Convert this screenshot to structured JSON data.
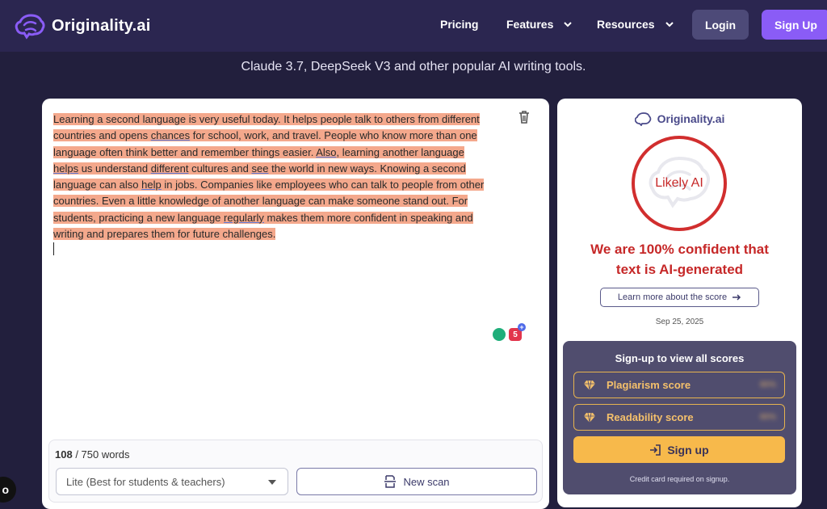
{
  "nav": {
    "brand": "Originality.ai",
    "links": [
      {
        "label": "Pricing"
      },
      {
        "label": "Features"
      },
      {
        "label": "Resources"
      }
    ],
    "login_label": "Login",
    "signup_label": "Sign Up"
  },
  "hero": {
    "line": "Claude 3.7, DeepSeek V3 and other popular AI writing tools."
  },
  "editor": {
    "text": {
      "s1": "Learning a second language is very useful today. It helps people talk to others from different countries and opens ",
      "w1": "chances",
      "s2": " for school, work, and travel. People who know more than one language often think better and remember things easier. ",
      "w2": "Also",
      "s3": ", learning another language ",
      "w3": "helps",
      "s4": " us understand ",
      "w4": "different",
      "s5": " cultures and ",
      "w5": "see",
      "s6": " the world in new ways. Knowing a second language can also ",
      "w6": "help",
      "s7": " in jobs. Companies like employees who can talk to people from other countries. Even a little knowledge of another language can make someone stand out. For students, practicing a new language ",
      "w7": "regularly",
      "s8": " makes them more confident in speaking and writing and prepares them for future challenges."
    },
    "extension_count": "5",
    "word_count": "108",
    "word_limit": " / 750 words",
    "mode_select": "Lite (Best for students & teachers)",
    "new_scan_label": "New scan"
  },
  "result": {
    "brand": "Originality.ai",
    "verdict": "Likely AI",
    "confidence_line1": "We are 100% confident that",
    "confidence_line2": "text is AI-generated",
    "learn_more_label": "Learn more about the score",
    "date": "Sep 25, 2025",
    "signup_box": {
      "title": "Sign-up to view all scores",
      "plagiarism_label": "Plagiarism score",
      "readability_label": "Readability score",
      "blurred_value": "80%",
      "cta_label": "Sign up",
      "note": "Credit card required on signup."
    }
  },
  "float_badge": "o",
  "colors": {
    "nav_bg": "#2b2650",
    "page_bg": "#221f3d",
    "accent_purple": "#8a5cf6",
    "highlight": "#f4a88c",
    "verdict_red": "#c62828",
    "signup_box_bg": "#504d6e",
    "cta_yellow": "#f7b94b"
  }
}
